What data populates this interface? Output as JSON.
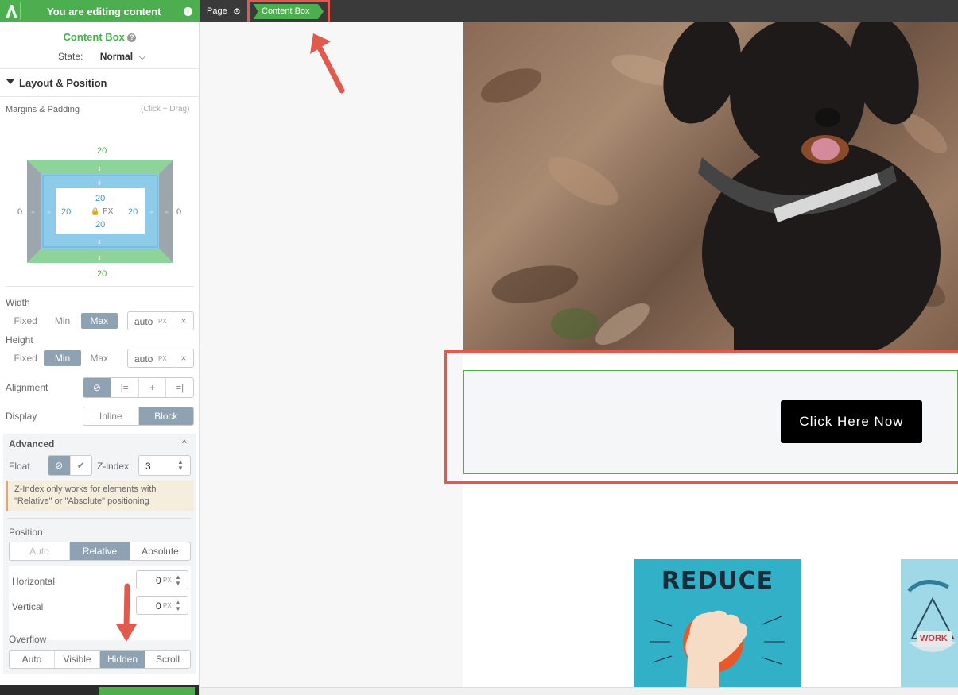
{
  "topbar": {
    "banner_text": "You are editing content",
    "info_glyph": "i",
    "page_label": "Page",
    "gear_glyph": "⚙",
    "breadcrumb_active": "Content Box"
  },
  "panel": {
    "title": "Content Box",
    "help_glyph": "?",
    "state_label": "State:",
    "state_value": "Normal",
    "state_chevron": "⌵",
    "section_title": "Layout & Position",
    "margins_label": "Margins & Padding",
    "margins_hint": "(Click + Drag)",
    "box_model": {
      "margin_top": "20",
      "margin_bottom": "20",
      "margin_left": "0",
      "margin_right": "0",
      "padding_top": "20",
      "padding_bottom": "20",
      "padding_left": "20",
      "padding_right": "20",
      "unit": "PX",
      "lock_glyph": "🔒"
    },
    "width": {
      "label": "Width",
      "options": [
        "Fixed",
        "Min",
        "Max"
      ],
      "selected": "Max",
      "value": "auto",
      "unit": "PX",
      "clear": "×"
    },
    "height": {
      "label": "Height",
      "options": [
        "Fixed",
        "Min",
        "Max"
      ],
      "selected": "Min",
      "value": "auto",
      "unit": "PX",
      "clear": "×"
    },
    "alignment": {
      "label": "Alignment",
      "icons": [
        "⊘",
        "|=",
        "+",
        "=|"
      ]
    },
    "display": {
      "label": "Display",
      "options": [
        "Inline",
        "Block"
      ],
      "selected": "Block"
    },
    "advanced": {
      "title": "Advanced",
      "collapse_glyph": "^",
      "float_label": "Float",
      "float_none_glyph": "⊘",
      "float_check_glyph": "✔",
      "zindex_label": "Z-index",
      "zindex_value": "3",
      "zindex_note": "Z-Index only works for elements with \"Relative\" or \"Absolute\" positioning",
      "position_label": "Position",
      "position_options": [
        "Auto",
        "Relative",
        "Absolute"
      ],
      "position_selected": "Relative",
      "horizontal_label": "Horizontal",
      "horizontal_value": "0",
      "vertical_label": "Vertical",
      "vertical_value": "0",
      "unit": "PX",
      "overflow_label": "Overflow",
      "overflow_options": [
        "Auto",
        "Visible",
        "Hidden",
        "Scroll"
      ],
      "overflow_selected": "Hidden"
    }
  },
  "canvas": {
    "cta_label": "Click Here Now",
    "reduce_word": "REDUCE",
    "work_word": "WORK"
  },
  "colors": {
    "accent_green": "#4cae4f",
    "highlight_red": "#e05a4e",
    "selected_gray": "#8fa2b3"
  }
}
